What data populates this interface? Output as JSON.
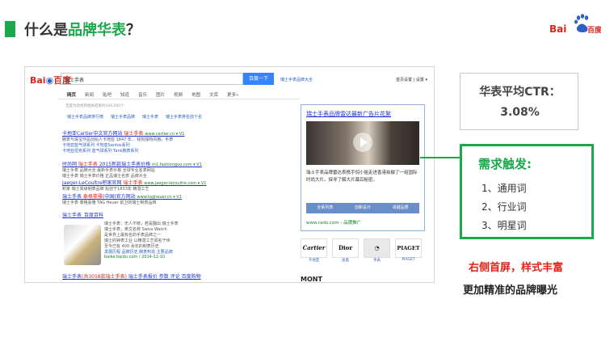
{
  "slide": {
    "title_prefix": "什么是",
    "title_highlight": "品牌华表",
    "title_suffix": "？"
  },
  "corner_logo": {
    "left": "Bai",
    "right": "百度"
  },
  "serp": {
    "logo_left": "Bai",
    "logo_right": "百度",
    "query": "瑞士手表",
    "search_button": "百度一下",
    "top_link": "瑞士手表品牌大全",
    "top_right": "首页设置 | 设置 ▾",
    "tabs": [
      "网页",
      "新闻",
      "贴吧",
      "知道",
      "音乐",
      "图片",
      "视频",
      "地图",
      "文库",
      "更多»"
    ],
    "result_count": "百度为您找到相关结果约100,000个",
    "suggest": [
      "瑞士手表品牌排行榜",
      "瑞士手表品牌",
      "瑞士手表",
      "瑞士手表排名前十名"
    ],
    "results": [
      {
        "title_pre": "卡地亚Cartier中文官方网站 ",
        "title_em": "瑞士手表",
        "url": "www.cartier.cn  ▾  V1",
        "lines": [
          "腕表与珠宝作品创始人卡地亚 1847 年... 铭刻独特风格，手表",
          "卡地亚蓝气球系列   卡地亚Santos系列",
          "卡地亚坦克系列   蓝气球系列   Tank腕表系列"
        ]
      },
      {
        "title_pre": "时尚网 ",
        "title_em": "瑞士手表",
        "title_post": " 2015新款瑞士手表价格",
        "url": "m1.fashionguo.com  ▾  V1",
        "lines": [
          "瑞士手表 品牌大全 最新手表价格 全球专业名表网站",
          "瑞士手表 瑞士手表价格 正品瑞士名表 品牌大全"
        ]
      },
      {
        "title_pre": "Jaeger-LeCoultre积家官网 ",
        "title_em": "瑞士手表",
        "url": "www.jaeger-lecoultre.com  ▾  V1",
        "lines": [
          "积家 瑞士高级制表品牌 始创于1833年 精湛工艺"
        ]
      },
      {
        "title_pre": "瑞士手表 ",
        "title_em": "泰格豪雅",
        "title_post": "(中国)官方网站",
        "url": "www.tagheuer.cn  ▾  V1",
        "lines": [
          "瑞士手表 泰格豪雅 TAG Heuer 前卫的瑞士制表品牌"
        ]
      }
    ],
    "wiki": {
      "title": "瑞士手表_百度百科",
      "lines": [
        "瑞士手表：无人不晓，若是翻出 瑞士手表",
        "瑞士手表，英文名称 Swiss Watch",
        "是世界上最有名的手表品牌之一",
        "瑞士的钟表工业 以精湛工艺闻名于世",
        "至今已有 400 余年的制表历史"
      ],
      "links": "发展历程   品牌历史   腕表构造   主要品牌",
      "url": "baike.baidu.com / 2014-12-10"
    },
    "bottom_result": {
      "title_pre": "瑞士手表",
      "title_em": "(共3058款瑞士手表)",
      "title_post": " 瑞士手表报价 参数 评论 百度购物"
    }
  },
  "ad": {
    "title": "瑞士手表品牌雷达最新广告片花絮",
    "desc": "瑞士手表品牌雷达表携手倪小姐走进香港拍摄了一组国际时尚大片。探寻了解大片幕后秘密。",
    "buttons": [
      "全系列表",
      "创新设计",
      "卓越品质"
    ],
    "url": "www.rado.com - 品牌推广",
    "brands": [
      {
        "name": "Cartier",
        "caption": "卡地亚"
      },
      {
        "name": "Dior",
        "caption": "迪奥"
      },
      {
        "name": "◔",
        "caption": "手表"
      },
      {
        "name": "PIAGET",
        "caption": "PIAGET"
      }
    ],
    "bottom_brand": "MONT"
  },
  "ctr": {
    "title": "华表平均CTR：",
    "value": "3.08%"
  },
  "trigger": {
    "title": "需求触发:",
    "items": [
      "1、通用词",
      "2、行业词",
      "3、明星词"
    ]
  },
  "notes": {
    "red": "右侧首屏，样式丰富",
    "dark": "更加精准的品牌曝光"
  },
  "colors": {
    "accent_green": "#1aa84a",
    "accent_red": "#e2231a",
    "baidu_blue": "#2b61c5"
  }
}
